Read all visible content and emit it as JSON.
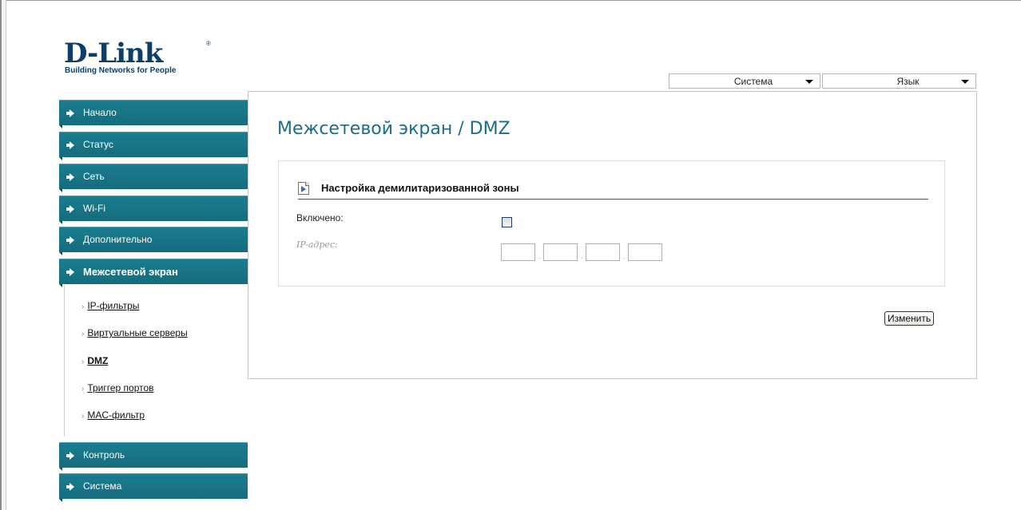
{
  "brand": {
    "name": "D-Link",
    "registered": "®",
    "tagline": "Building Networks for People"
  },
  "top_dropdowns": {
    "system": {
      "value": "Система"
    },
    "language": {
      "value": "Язык"
    }
  },
  "menu": {
    "items": [
      {
        "label": "Начало"
      },
      {
        "label": "Статус"
      },
      {
        "label": "Сеть"
      },
      {
        "label": "Wi-Fi"
      },
      {
        "label": "Дополнительно"
      },
      {
        "label": "Межсетевой экран",
        "active": true
      },
      {
        "label": "Контроль"
      },
      {
        "label": "Система"
      }
    ],
    "submenu": [
      {
        "label": "IP-фильтры"
      },
      {
        "label": "Виртуальные серверы"
      },
      {
        "label": "DMZ",
        "current": true
      },
      {
        "label": "Триггер портов"
      },
      {
        "label": "MAC-фильтр"
      }
    ]
  },
  "page": {
    "title": "Межсетевой экран / DMZ",
    "section_title": "Настройка демилитаризованной зоны",
    "enabled_label": "Включено:",
    "enabled_checked": false,
    "ip_label": "IP-адрес:",
    "ip_octets": [
      "",
      "",
      "",
      ""
    ],
    "ip_separator": ".",
    "change_button": "Изменить"
  },
  "colors": {
    "menu_bg": "#1b7d90",
    "title_color": "#1a6f86",
    "brand_color": "#0b3f6b"
  }
}
